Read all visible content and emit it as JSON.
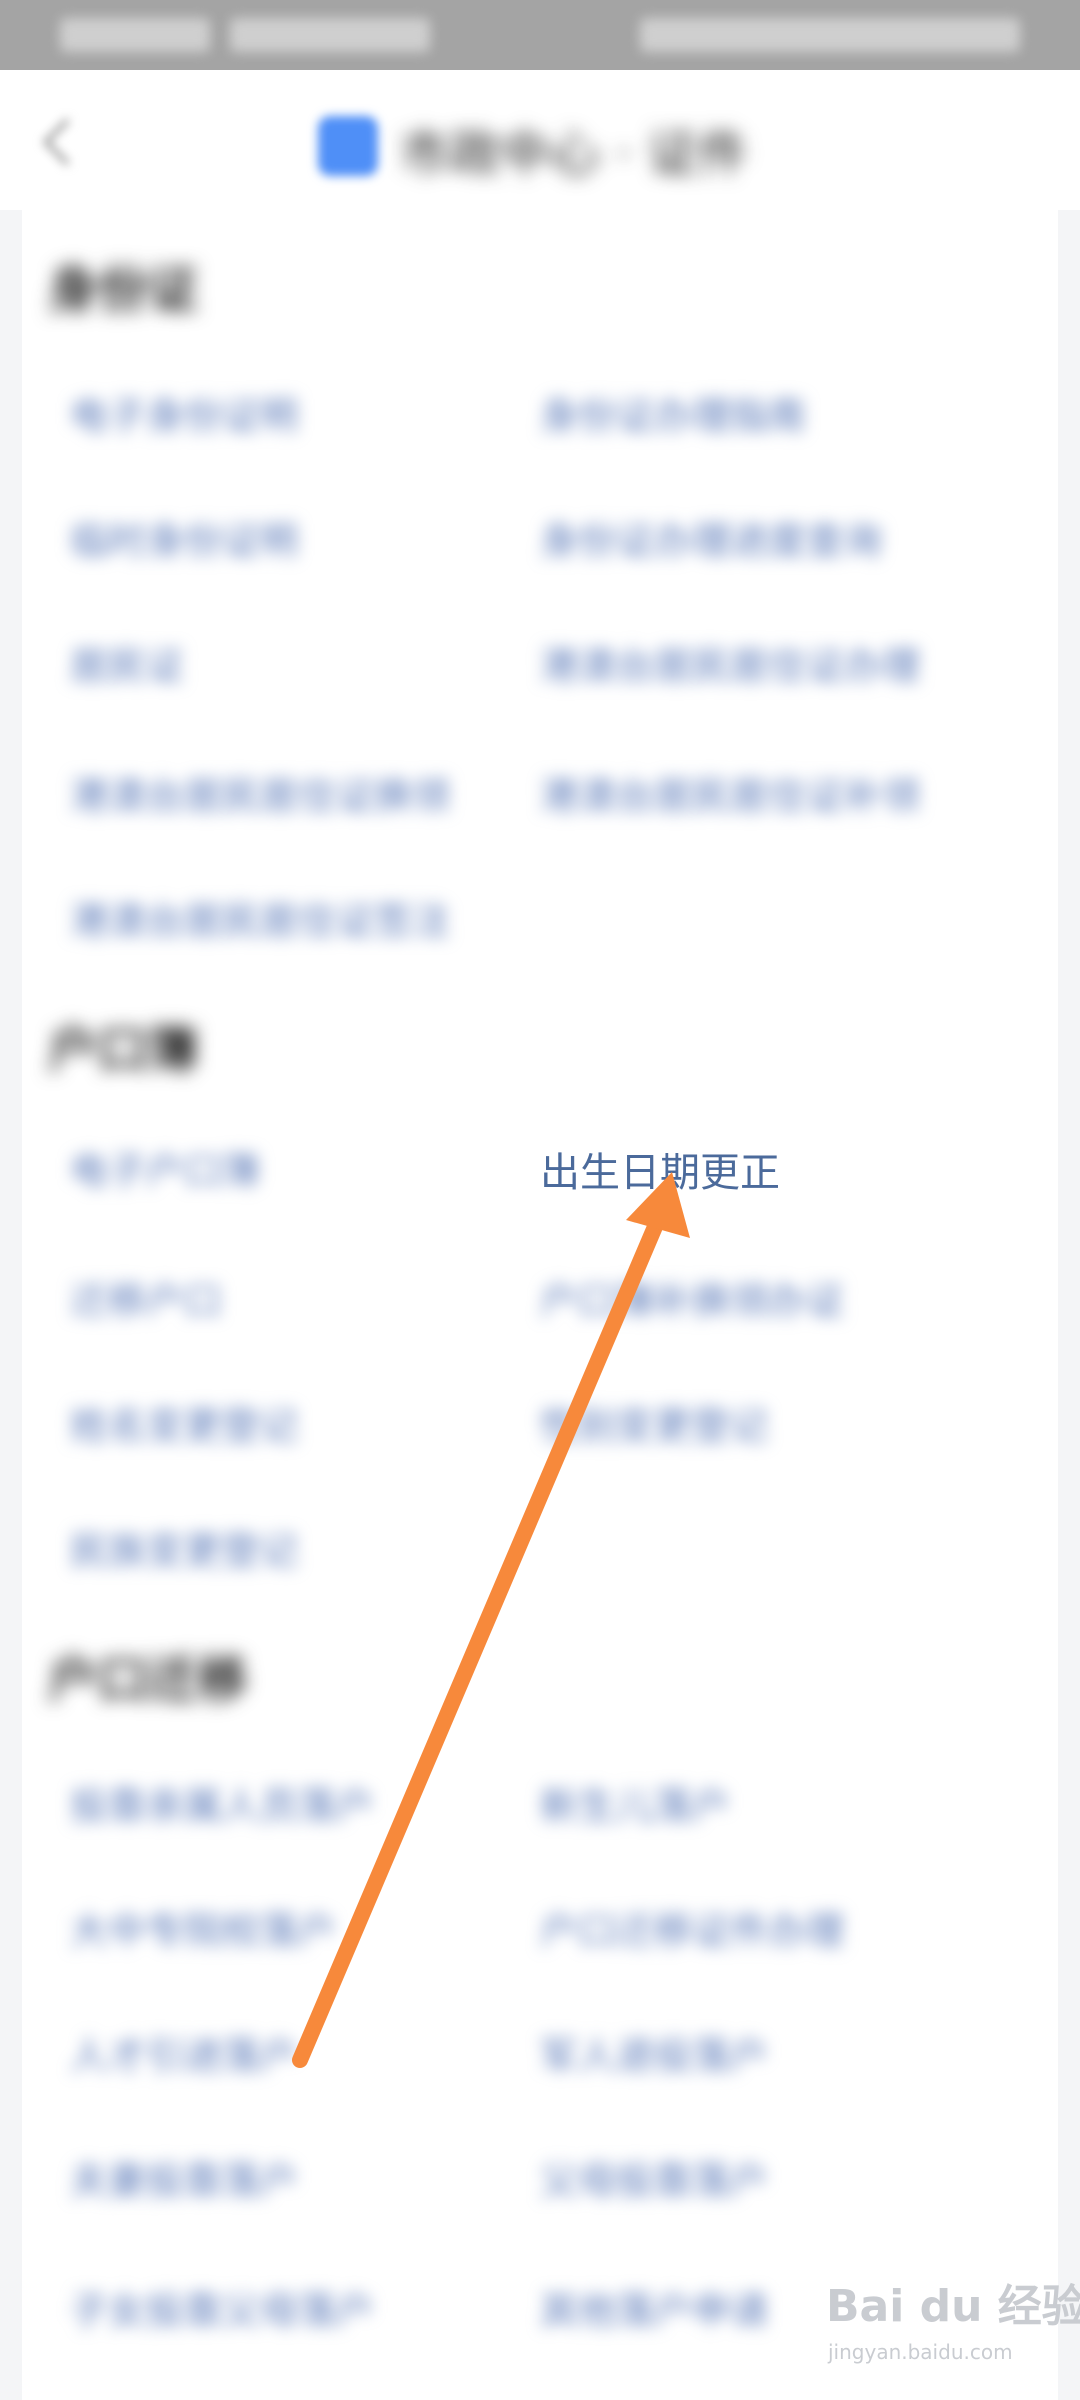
{
  "header": {
    "title": "市政中心 · 证件"
  },
  "sections": [
    {
      "title": "身份证",
      "items": [
        "电子身份证明",
        "身份证办理指南",
        "临时身份证明",
        "身份证办理进度查询",
        "居民证",
        "港澳台居民居住证办理",
        "港澳台居民居住证换领",
        "港澳台居民居住证补领",
        "港澳台居民居住证签注"
      ]
    },
    {
      "title": "户口簿",
      "items": [
        "电子户口簿",
        "出生日期更正",
        "迁移户口",
        "户口簿补换领办证",
        "姓名变更登记",
        "性别变更登记",
        "民族变更登记"
      ]
    },
    {
      "title": "户口迁移",
      "items": [
        "投靠亲属人员落户",
        "新生儿落户",
        "大中专院校落户",
        "户口迁移证件办理",
        "人才引进落户",
        "军人退役落户",
        "夫妻投靠落户",
        "父母投靠落户",
        "子女投靠父母落户",
        "其他落户申请"
      ]
    }
  ],
  "focus_item": "出生日期更正",
  "watermark": {
    "logo": "Bai du 经验",
    "url": "jingyan.baidu.com"
  },
  "annotation": {
    "arrow_color": "#f7893b"
  }
}
